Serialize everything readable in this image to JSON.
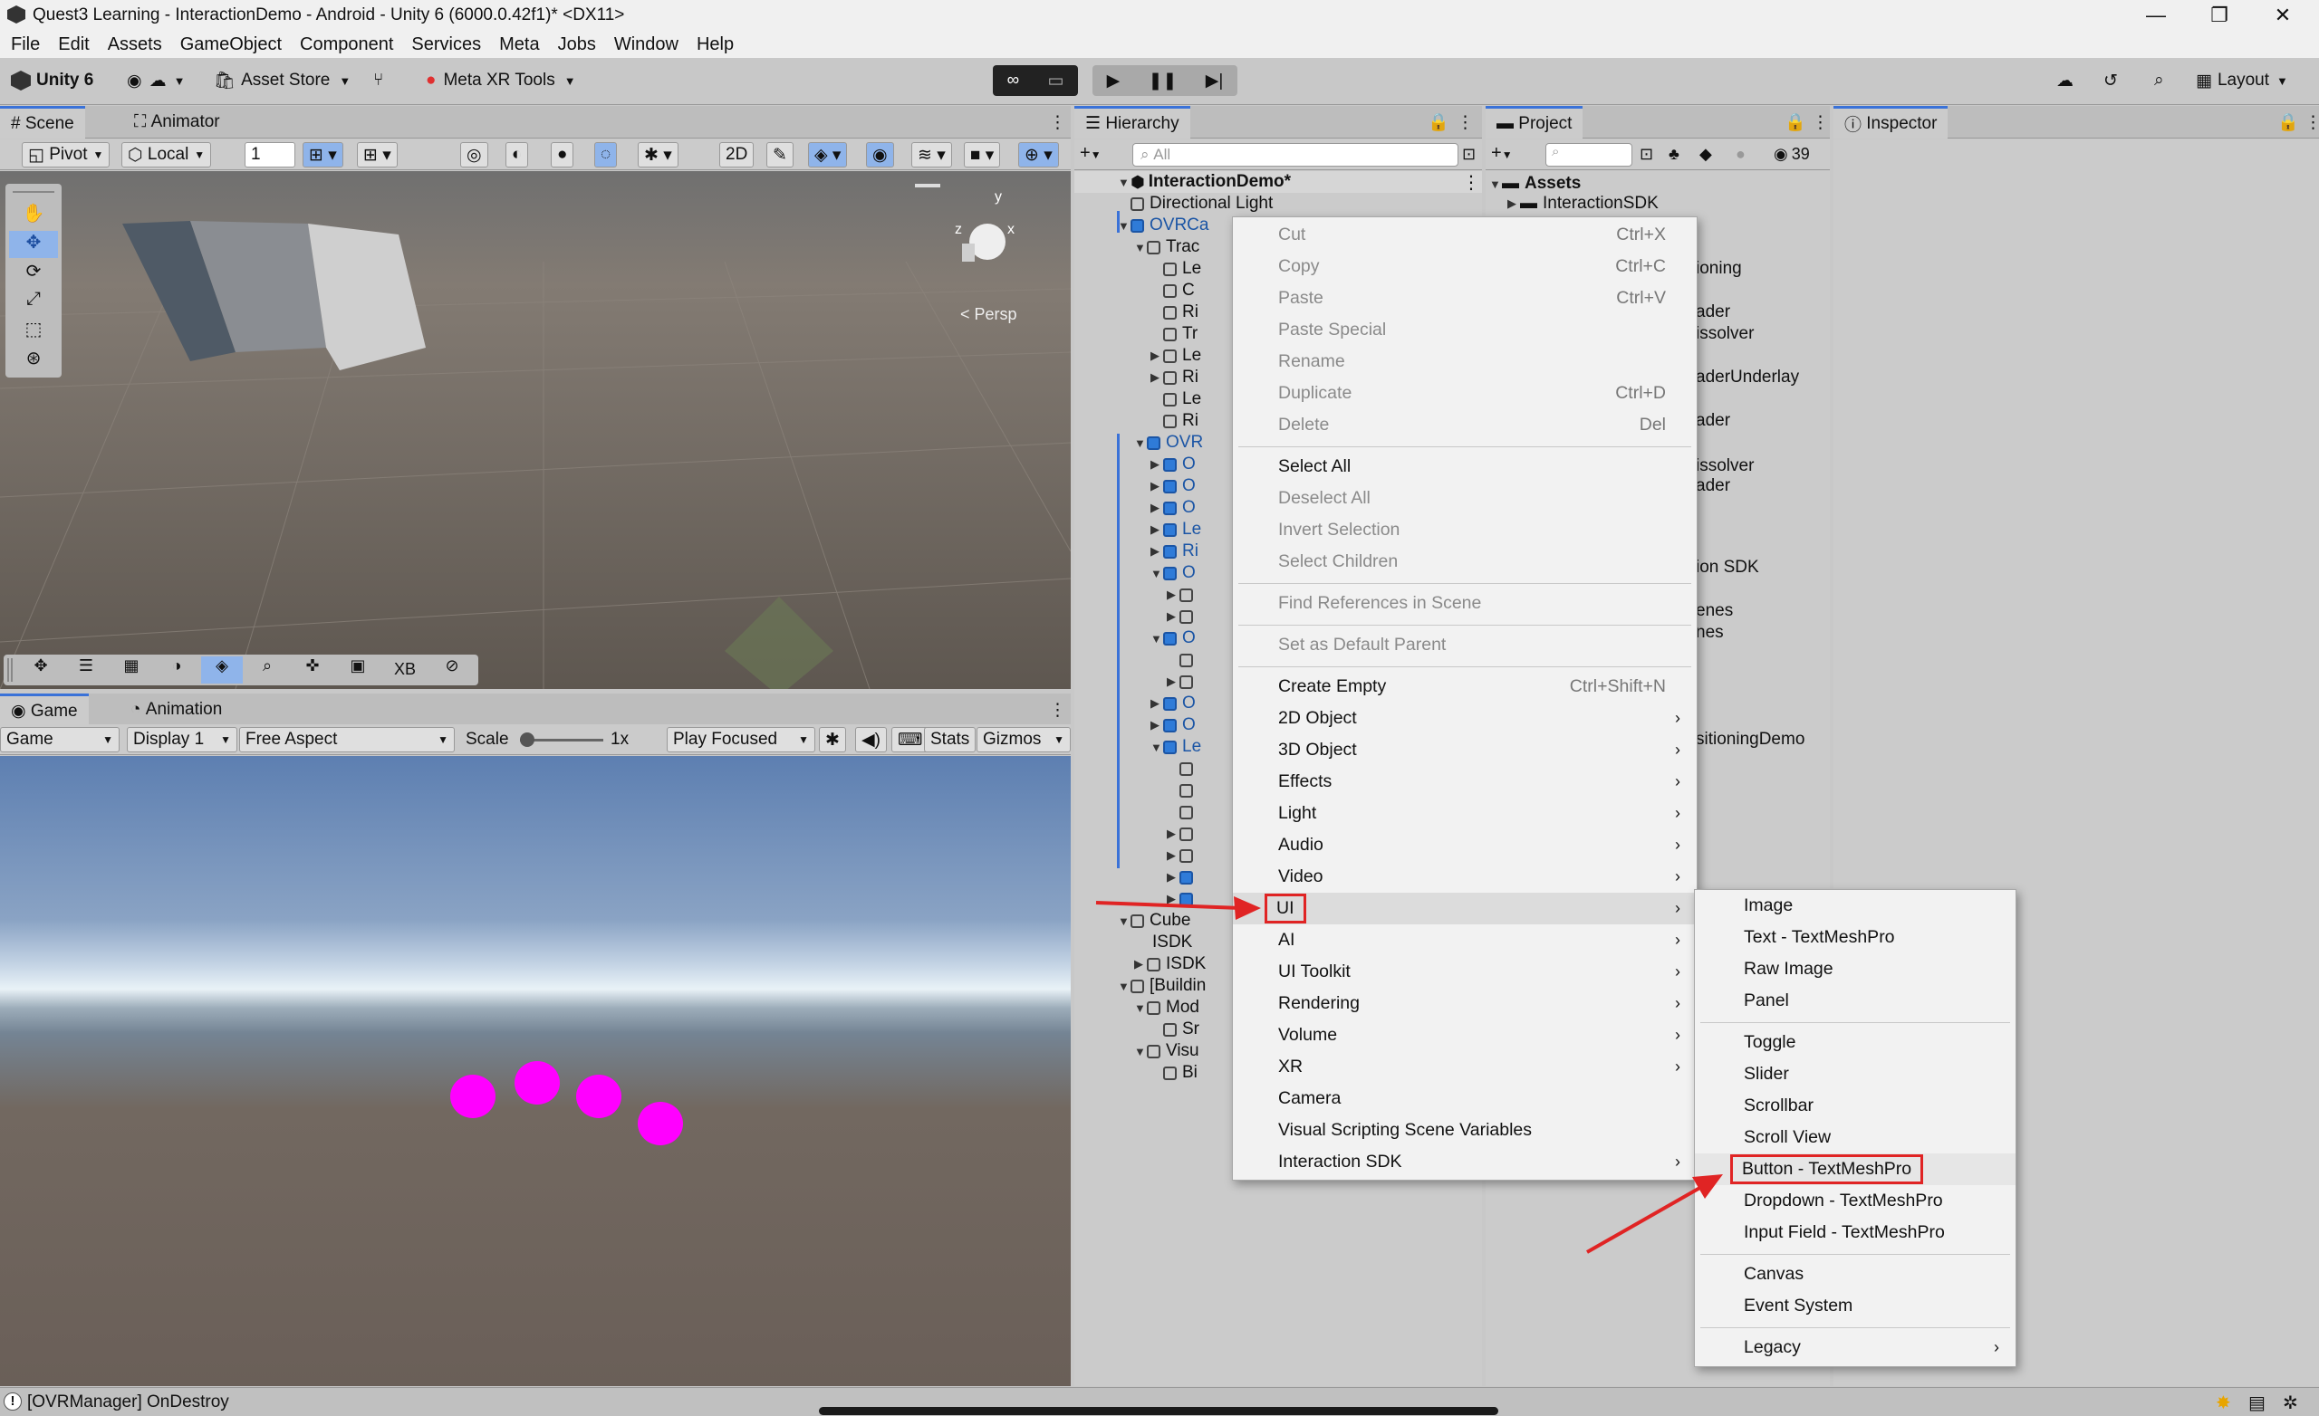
{
  "window": {
    "title": "Quest3 Learning - InteractionDemo - Android - Unity 6 (6000.0.42f1)* <DX11>"
  },
  "menubar": [
    "File",
    "Edit",
    "Assets",
    "GameObject",
    "Component",
    "Services",
    "Meta",
    "Jobs",
    "Window",
    "Help"
  ],
  "toolbar": {
    "unity": "Unity 6",
    "asset_store": "Asset Store",
    "meta_tools": "Meta XR Tools",
    "layout": "Layout"
  },
  "scene": {
    "tabs": [
      "Scene",
      "Animator"
    ],
    "pivot": "Pivot",
    "local": "Local",
    "grid_value": "1",
    "persp": "< Persp",
    "gizmo_axes": [
      "y",
      "z",
      "x"
    ]
  },
  "scene_bottom_tools": {
    "xb": "XB"
  },
  "game": {
    "tabs": [
      "Game",
      "Animation"
    ],
    "display_mode": "Game",
    "display": "Display 1",
    "aspect": "Free Aspect",
    "scale_label": "Scale",
    "scale_value": "1x",
    "play_focused": "Play Focused",
    "stats": "Stats",
    "gizmos": "Gizmos"
  },
  "hierarchy": {
    "tab": "Hierarchy",
    "search_placeholder": "All",
    "scene_name": "InteractionDemo*",
    "rows": [
      {
        "t": "Directional Light",
        "i": 1,
        "c": "g",
        "x": "n"
      },
      {
        "t": "OVRCa",
        "i": 1,
        "c": "b",
        "x": "d"
      },
      {
        "t": "Trac",
        "i": 2,
        "c": "g",
        "x": "d"
      },
      {
        "t": "Le",
        "i": 3,
        "c": "g",
        "x": "n"
      },
      {
        "t": "C",
        "i": 3,
        "c": "g",
        "x": "n"
      },
      {
        "t": "Ri",
        "i": 3,
        "c": "g",
        "x": "n"
      },
      {
        "t": "Tr",
        "i": 3,
        "c": "g",
        "x": "n"
      },
      {
        "t": "Le",
        "i": 3,
        "c": "g",
        "x": "r"
      },
      {
        "t": "Ri",
        "i": 3,
        "c": "g",
        "x": "r"
      },
      {
        "t": "Le",
        "i": 3,
        "c": "g",
        "x": "n"
      },
      {
        "t": "Ri",
        "i": 3,
        "c": "g",
        "x": "n"
      },
      {
        "t": "OVR",
        "i": 2,
        "c": "b",
        "x": "d"
      },
      {
        "t": "O",
        "i": 3,
        "c": "b",
        "x": "r"
      },
      {
        "t": "O",
        "i": 3,
        "c": "b",
        "x": "r"
      },
      {
        "t": "O",
        "i": 3,
        "c": "b",
        "x": "r"
      },
      {
        "t": "Le",
        "i": 3,
        "c": "b",
        "x": "r"
      },
      {
        "t": "Ri",
        "i": 3,
        "c": "b",
        "x": "r"
      },
      {
        "t": "O",
        "i": 3,
        "c": "b",
        "x": "d"
      },
      {
        "t": "",
        "i": 4,
        "c": "g",
        "x": "r"
      },
      {
        "t": "",
        "i": 4,
        "c": "g",
        "x": "r"
      },
      {
        "t": "O",
        "i": 3,
        "c": "b",
        "x": "d"
      },
      {
        "t": "",
        "i": 4,
        "c": "g",
        "x": "n"
      },
      {
        "t": "",
        "i": 4,
        "c": "g",
        "x": "r"
      },
      {
        "t": "O",
        "i": 3,
        "c": "b",
        "x": "r"
      },
      {
        "t": "O",
        "i": 3,
        "c": "b",
        "x": "r"
      },
      {
        "t": "Le",
        "i": 3,
        "c": "b",
        "x": "d"
      },
      {
        "t": "",
        "i": 4,
        "c": "g",
        "x": "n"
      },
      {
        "t": "",
        "i": 4,
        "c": "g",
        "x": "n"
      },
      {
        "t": "",
        "i": 4,
        "c": "g",
        "x": "n"
      },
      {
        "t": "",
        "i": 4,
        "c": "g",
        "x": "r"
      },
      {
        "t": "",
        "i": 4,
        "c": "g",
        "x": "r"
      },
      {
        "t": "",
        "i": 4,
        "c": "b",
        "x": "r"
      },
      {
        "t": "",
        "i": 4,
        "c": "b",
        "x": "r"
      },
      {
        "t": "Cube",
        "i": 1,
        "c": "g",
        "x": "d"
      },
      {
        "t": "ISDK",
        "i": 2,
        "c": "n",
        "x": "n"
      },
      {
        "t": "ISDK",
        "i": 2,
        "c": "g",
        "x": "r"
      },
      {
        "t": "[Buildin",
        "i": 1,
        "c": "g",
        "x": "d"
      },
      {
        "t": "Mod",
        "i": 2,
        "c": "g",
        "x": "d"
      },
      {
        "t": "Sr",
        "i": 3,
        "c": "g",
        "x": "n"
      },
      {
        "t": "Visu",
        "i": 2,
        "c": "g",
        "x": "d"
      },
      {
        "t": "Bi",
        "i": 3,
        "c": "g",
        "x": "n"
      }
    ]
  },
  "project": {
    "tab": "Project",
    "count": "39",
    "root": "Assets",
    "items": [
      {
        "t": "InteractionSDK",
        "f": true
      },
      {
        "t": "ioning"
      },
      {
        "t": "ader"
      },
      {
        "t": "issolver"
      },
      {
        "t": "aderUnderlay"
      },
      {
        "t": "ader"
      },
      {
        "t": "issolver"
      },
      {
        "t": "ader"
      },
      {
        "t": "ion SDK"
      },
      {
        "t": "enes"
      },
      {
        "t": "nes"
      },
      {
        "t": "sitioningDemo"
      }
    ]
  },
  "inspector": {
    "tab": "Inspector"
  },
  "context_menu": [
    {
      "label": "Cut",
      "shortcut": "Ctrl+X",
      "disabled": true
    },
    {
      "label": "Copy",
      "shortcut": "Ctrl+C",
      "disabled": true
    },
    {
      "label": "Paste",
      "shortcut": "Ctrl+V",
      "disabled": true
    },
    {
      "label": "Paste Special",
      "disabled": true
    },
    {
      "label": "Rename",
      "disabled": true
    },
    {
      "label": "Duplicate",
      "shortcut": "Ctrl+D",
      "disabled": true
    },
    {
      "label": "Delete",
      "shortcut": "Del",
      "disabled": true
    },
    {
      "sep": true
    },
    {
      "label": "Select All"
    },
    {
      "label": "Deselect All",
      "disabled": true
    },
    {
      "label": "Invert Selection",
      "disabled": true
    },
    {
      "label": "Select Children",
      "disabled": true
    },
    {
      "sep": true
    },
    {
      "label": "Find References in Scene",
      "disabled": true
    },
    {
      "sep": true
    },
    {
      "label": "Set as Default Parent",
      "disabled": true
    },
    {
      "sep": true
    },
    {
      "label": "Create Empty",
      "shortcut": "Ctrl+Shift+N"
    },
    {
      "label": "2D Object",
      "submenu": true
    },
    {
      "label": "3D Object",
      "submenu": true
    },
    {
      "label": "Effects",
      "submenu": true
    },
    {
      "label": "Light",
      "submenu": true
    },
    {
      "label": "Audio",
      "submenu": true
    },
    {
      "label": "Video",
      "submenu": true
    },
    {
      "label": "UI",
      "submenu": true,
      "active": true,
      "highlight": true
    },
    {
      "label": "AI",
      "submenu": true
    },
    {
      "label": "UI Toolkit",
      "submenu": true
    },
    {
      "label": "Rendering",
      "submenu": true
    },
    {
      "label": "Volume",
      "submenu": true
    },
    {
      "label": "XR",
      "submenu": true
    },
    {
      "label": "Camera"
    },
    {
      "label": "Visual Scripting Scene Variables"
    },
    {
      "label": "Interaction SDK",
      "submenu": true
    }
  ],
  "ui_submenu": [
    {
      "label": "Image"
    },
    {
      "label": "Text - TextMeshPro"
    },
    {
      "label": "Raw Image"
    },
    {
      "label": "Panel"
    },
    {
      "sep": true
    },
    {
      "label": "Toggle"
    },
    {
      "label": "Slider"
    },
    {
      "label": "Scrollbar"
    },
    {
      "label": "Scroll View"
    },
    {
      "label": "Button - TextMeshPro",
      "highlight": true
    },
    {
      "label": "Dropdown - TextMeshPro"
    },
    {
      "label": "Input Field - TextMeshPro"
    },
    {
      "sep": true
    },
    {
      "label": "Canvas"
    },
    {
      "label": "Event System"
    },
    {
      "sep": true
    },
    {
      "label": "Legacy",
      "submenu": true
    }
  ],
  "status": {
    "message": "[OVRManager] OnDestroy"
  },
  "colors": {
    "accent": "#3a72d8",
    "annotation": "#e02424",
    "magenta": "#ff00ff"
  }
}
